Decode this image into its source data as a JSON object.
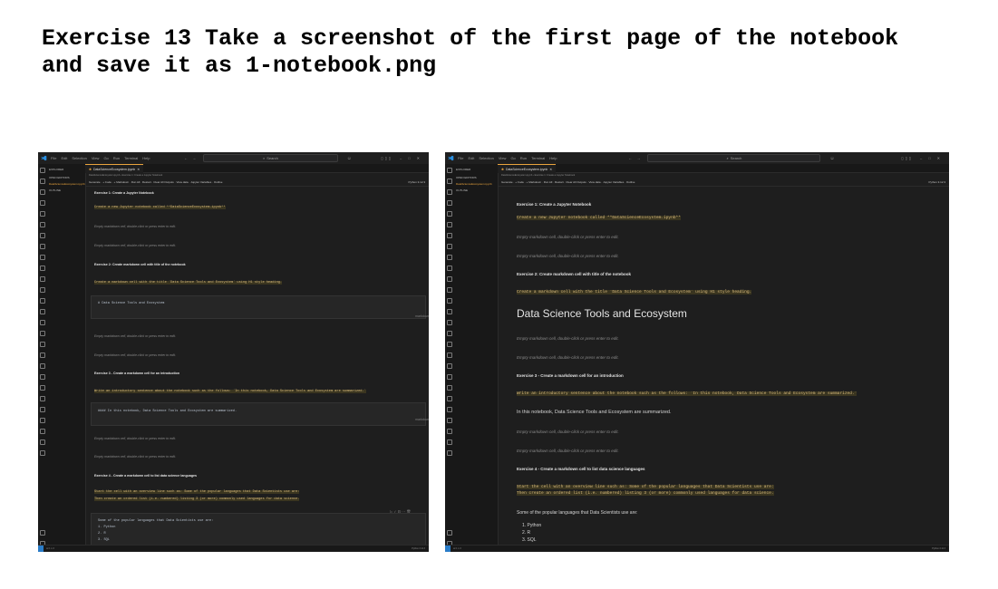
{
  "heading": {
    "line1": "Exercise 13 Take a screenshot of the first page of the notebook",
    "line2": "and save it as 1-notebook.png"
  },
  "vscode": {
    "menu": [
      "File",
      "Edit",
      "Selection",
      "View",
      "Go",
      "Run",
      "Terminal",
      "Help"
    ],
    "search_placeholder": "Search",
    "explorer_title": "EXPLORER",
    "open_editors": "OPEN EDITORS",
    "outline": "OUTLINE",
    "tab_label": "DataScienceEcosystem.ipynb",
    "toolbar": [
      "Generate",
      "+ Code",
      "+ Markdown",
      "Run All",
      "Restart",
      "Clear All Outputs",
      "View data",
      "Jupyter Variables",
      "Outline"
    ],
    "kernel": "Python 3.12.3",
    "icons": {
      "logo": "vscode-logo-icon",
      "search": "search-icon",
      "copilot": "copilot-icon",
      "explorer": "files-icon",
      "run_all": "play-icon",
      "restart": "restart-icon",
      "tab_file": "notebook-icon"
    },
    "accent_color": "#e8a33d"
  },
  "notebook": {
    "ex1_title": "Exercise 1: Create a Jupyter Notebook",
    "ex1_code": "Create a new Jupyter notebook called **DataScienceEcosystem.ipynb**",
    "empty_cell": "Empty markdown cell, double-click or press enter to edit.",
    "ex2_title": "Exercise 2: Create markdown cell with title of the notebook",
    "ex2_code": "Create a markdown cell with the title `Data Science Tools and Ecosystem` using H1 style heading.",
    "ex2_source": "# Data Science Tools and Ecosystem",
    "ex2_rendered": "Data Science Tools and Ecosystem",
    "cell_tag": "markdown",
    "ex3_title": "Exercise 3 - Create a markdown cell for an introduction",
    "ex3_code": "Write an introductory sentence about the notebook such as the follows: `In this notebook, Data Science Tools and Ecosystem are summarized.`",
    "ex3_source": "#### In this notebook, Data Science Tools and Ecosystem are summarized.",
    "ex3_rendered": "In this notebook, Data Science Tools and Ecosystem are summarized.",
    "ex4_title": "Exercise 4 - Create a markdown cell to list data science languages",
    "ex4_code1": "Start the cell with an overview line such as: Some of the popular languages that Data Scientists use are:",
    "ex4_code2": "Then create an ordered list (i.e. numbered) listing 3 (or more) commonly used languages for data science.",
    "ex4_intro": "Some of the popular languages that Data Scientists use are:",
    "languages": [
      "1. Python",
      "2. R",
      "3. SQL"
    ]
  }
}
